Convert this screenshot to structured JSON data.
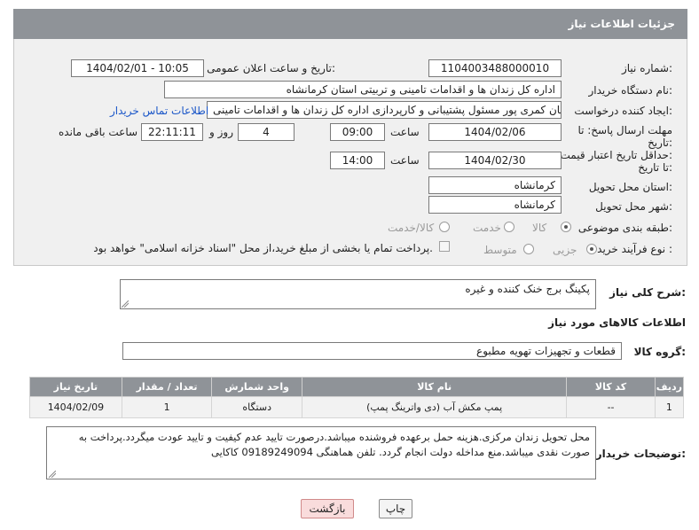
{
  "header": {
    "title": "جزئیات اطلاعات نیاز"
  },
  "fields": {
    "need_number_label": "شماره نیاز:",
    "need_number": "1104003488000010",
    "announce_label": "تاریخ و ساعت اعلان عمومی:",
    "announce_value": "1404/02/01 - 10:05",
    "buyer_label": "نام دستگاه خریدار:",
    "buyer_value": "اداره کل زندان ها و اقدامات تامینی و تربیتی استان کرمانشاه",
    "creator_label": "ایجاد کننده درخواست:",
    "creator_value": "پیمان کمری پور مسئول پشتیبانی و کارپردازی اداره کل زندان ها و اقدامات تامینی",
    "contact_link": "اطلاعات تماس خریدار",
    "deadline_label_1": "مهلت ارسال پاسخ: تا",
    "deadline_label_2": "تاریخ:",
    "deadline_date": "1404/02/06",
    "time_label": "ساعت",
    "deadline_time": "09:00",
    "days_value": "4",
    "days_label": "روز و",
    "remaining_time": "22:11:11",
    "remaining_label": "ساعت باقی مانده",
    "min_price_label_1": "حداقل تاریخ اعتبار قیمت:",
    "min_price_label_2": "تا تاریخ:",
    "price_date": "1404/02/30",
    "price_time": "14:00",
    "province_label": "استان محل تحویل:",
    "province_value": "کرمانشاه",
    "city_label": "شهر محل تحویل:",
    "city_value": "کرمانشاه",
    "category_label": "طبقه بندی موضوعی:",
    "category_options": [
      "کالا",
      "خدمت",
      "کالا/خدمت"
    ],
    "category_selected": "کالا",
    "process_label": "نوع فرآیند خرید :",
    "process_options": [
      "جزیی",
      "متوسط"
    ],
    "process_selected": "جزیی",
    "payment_note": "پرداخت تمام یا بخشی از مبلغ خرید،از محل \"اسناد خزانه اسلامی\" خواهد بود."
  },
  "description": {
    "label": "شرح کلی نیاز:",
    "value": "پکینگ برج خنک کننده و غیره"
  },
  "goods": {
    "section_title": "اطلاعات کالاهای مورد نیاز",
    "group_label": "گروه کالا:",
    "group_value": "قطعات و تجهیزات تهویه مطبوع",
    "columns": [
      "ردیف",
      "کد کالا",
      "نام کالا",
      "واحد شمارش",
      "تعداد / مقدار",
      "تاریخ نیاز"
    ],
    "rows": [
      [
        "1",
        "--",
        "پمپ مکش آب (دی واترینگ پمپ)",
        "دستگاه",
        "1",
        "1404/02/09"
      ]
    ]
  },
  "buyer_notes": {
    "label": "توضیحات خریدار:",
    "value": "محل تحویل زندان مرکزی.هزینه حمل برعهده فروشنده میباشد.درصورت تایید عدم کیفیت و تایید عودت میگردد.پرداخت به صورت نقدی میباشد.منع مداخله دولت انجام گردد. تلفن هماهنگی 09189249094 کاکایی"
  },
  "buttons": {
    "print": "چاپ",
    "back": "بازگشت"
  },
  "colors": {
    "header": "#8f9398",
    "link": "#1a56c8",
    "back_button": "#f9dcdc"
  }
}
